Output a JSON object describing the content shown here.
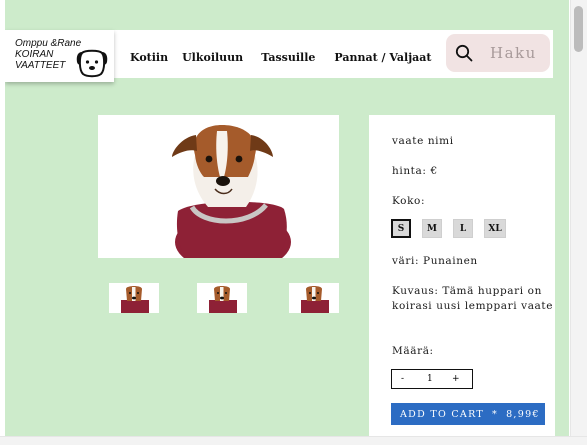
{
  "logo": {
    "line1": "Omppu &Rane",
    "line2": "KOIRAN",
    "line3": "VAATTEET"
  },
  "nav": [
    {
      "label": "Kotiin"
    },
    {
      "label": "Ulkoiluun"
    },
    {
      "label": "Tassuille"
    },
    {
      "label": "Pannat / Valjaat"
    }
  ],
  "search": {
    "placeholder": "Haku"
  },
  "product": {
    "name": "vaate nimi",
    "price": "hinta: €",
    "size_label": "Koko:",
    "sizes": [
      "S",
      "M",
      "L",
      "XL"
    ],
    "selected_size": "S",
    "color": "väri: Punainen",
    "description": "Kuvaus: Tämä huppari on koirasi uusi lemppari vaate",
    "quantity_label": "Määrä:",
    "quantity_minus": "-",
    "quantity_value": "1",
    "quantity_plus": "+",
    "cart": {
      "label": "ADD TO CART",
      "separator": "*",
      "price": "8,99€"
    }
  },
  "colors": {
    "background": "#cdebcb",
    "cart_button": "#2c6cc3",
    "search_bg": "#f1e3e3",
    "hoodie": "#8e2136"
  }
}
